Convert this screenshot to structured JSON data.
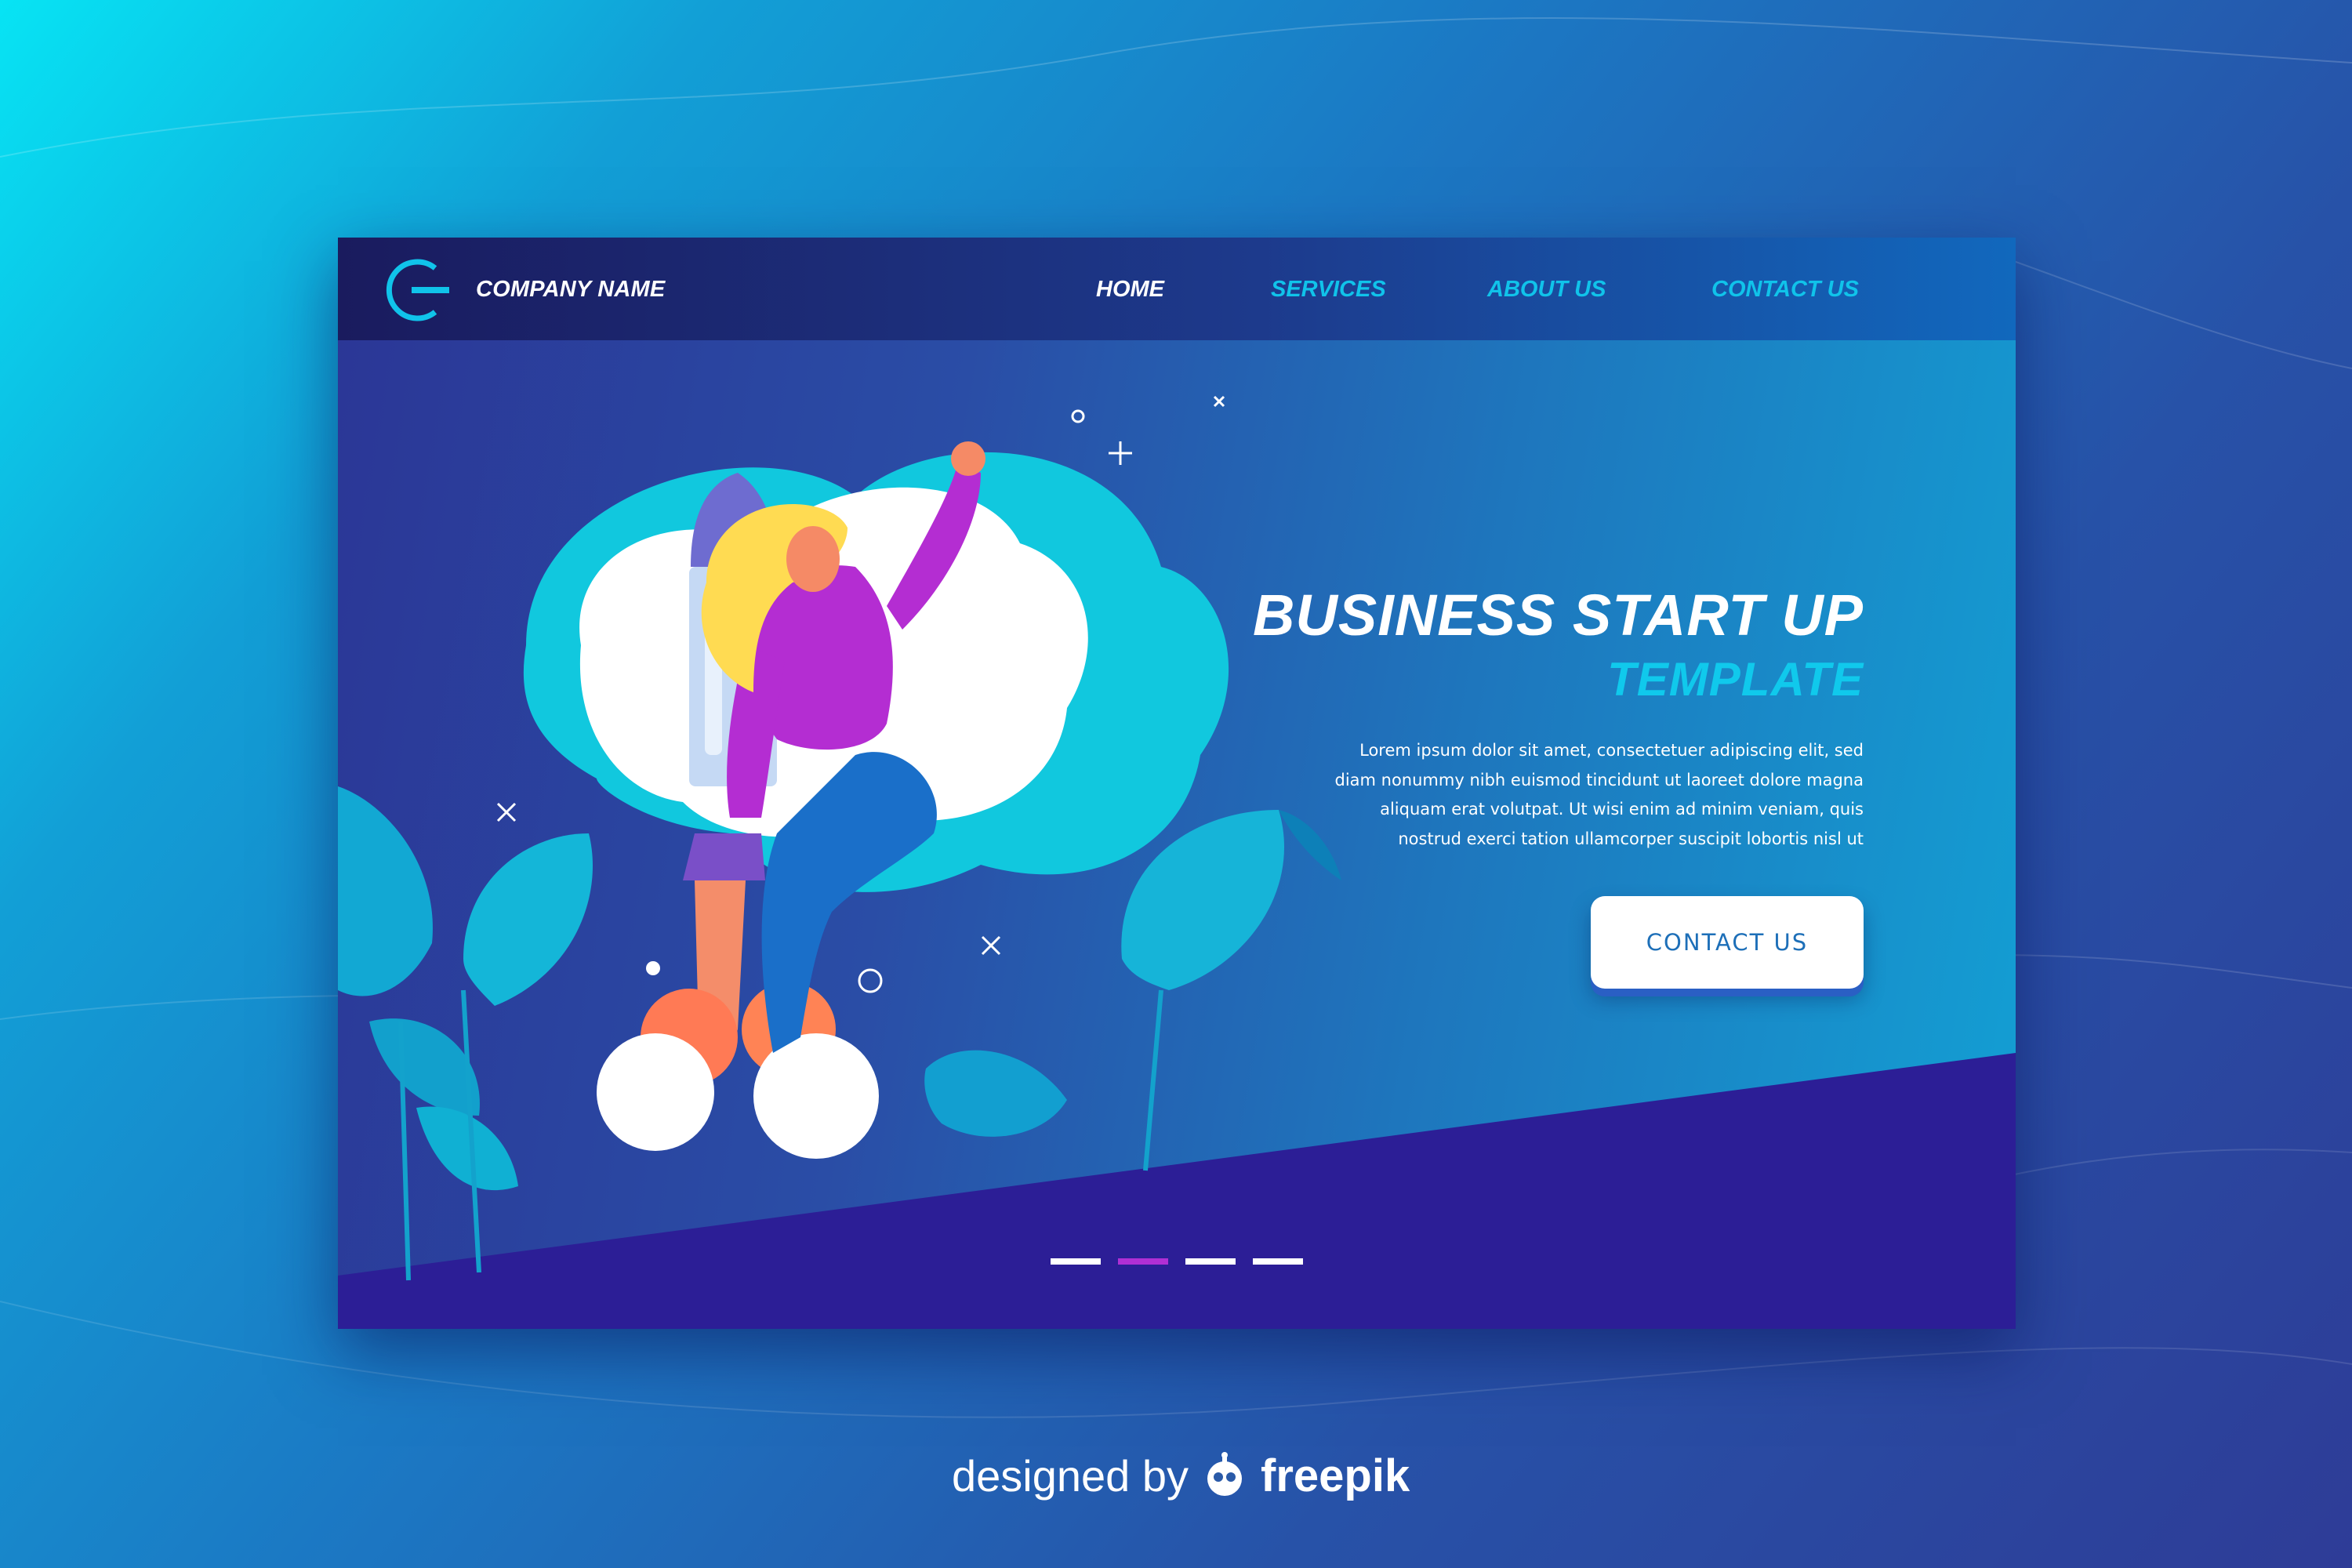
{
  "nav": {
    "company_name": "COMPANY NAME",
    "links": [
      {
        "label": "HOME",
        "active": true
      },
      {
        "label": "SERVICES",
        "active": false
      },
      {
        "label": "ABOUT US",
        "active": false
      },
      {
        "label": "CONTACT US",
        "active": false
      }
    ]
  },
  "hero": {
    "title": "BUSINESS START UP",
    "subtitle": "TEMPLATE",
    "body": "Lorem ipsum dolor sit amet, consectetuer adipiscing elit, sed diam nonummy nibh euismod tincidunt ut laoreet dolore magna aliquam erat volutpat. Ut wisi enim ad minim veniam, quis nostrud exerci tation ullamcorper suscipit lobortis nisl ut",
    "cta_label": "CONTACT US"
  },
  "slider": {
    "count": 4,
    "active_index": 1
  },
  "credit": {
    "prefix": "designed by",
    "brand": "freepik"
  },
  "colors": {
    "accent_cyan": "#10c3ea",
    "navbar_dark": "#1a1b5e",
    "card_bottom": "#2c1e96",
    "active_dot": "#b02fd4",
    "cta_text": "#1d6fb8"
  },
  "icons": [
    "company-logo-icon",
    "woman-rocket-illustration",
    "plant-leaves",
    "freepik-robot-icon"
  ]
}
